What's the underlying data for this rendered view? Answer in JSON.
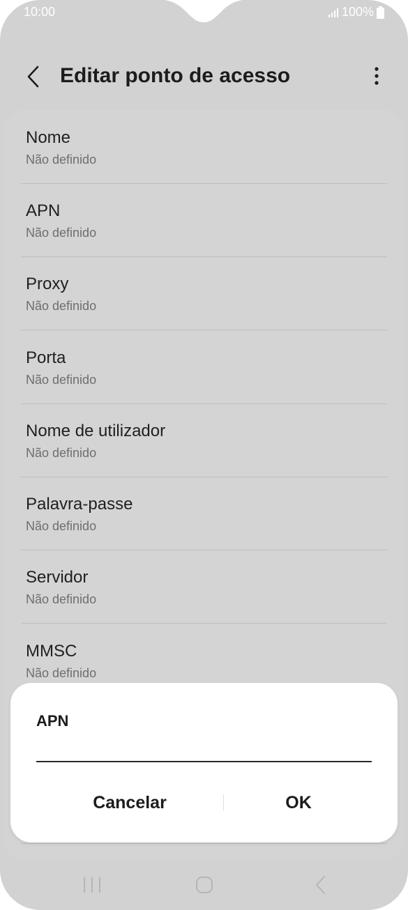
{
  "status_bar": {
    "time": "10:00",
    "battery": "100%",
    "icons": [
      "signal-icon",
      "battery-icon"
    ]
  },
  "app_bar": {
    "title": "Editar ponto de acesso",
    "back_icon": "back-chevron-icon",
    "more_icon": "more-vertical-icon"
  },
  "settings": {
    "items": [
      {
        "label": "Nome",
        "value": "Não definido"
      },
      {
        "label": "APN",
        "value": "Não definido"
      },
      {
        "label": "Proxy",
        "value": "Não definido"
      },
      {
        "label": "Porta",
        "value": "Não definido"
      },
      {
        "label": "Nome de utilizador",
        "value": "Não definido"
      },
      {
        "label": "Palavra-passe",
        "value": "Não definido"
      },
      {
        "label": "Servidor",
        "value": "Não definido"
      },
      {
        "label": "MMSC",
        "value": "Não definido"
      }
    ]
  },
  "dialog": {
    "title": "APN",
    "input_value": "",
    "cancel_label": "Cancelar",
    "ok_label": "OK"
  },
  "nav_bar": {
    "icons": [
      "recents-icon",
      "home-icon",
      "back-icon"
    ]
  },
  "colors": {
    "background": "#d2d2d2",
    "dialog": "#ffffff",
    "text_primary": "#1f1f1f",
    "text_secondary": "#6e6e6e"
  }
}
